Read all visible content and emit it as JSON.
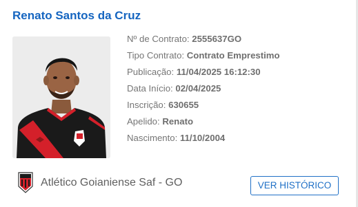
{
  "player": {
    "name": "Renato Santos da Cruz"
  },
  "details": [
    {
      "label": "Nº de Contrato: ",
      "value": "2555637GO"
    },
    {
      "label": "Tipo Contrato: ",
      "value": "Contrato Emprestimo"
    },
    {
      "label": "Publicação: ",
      "value": "11/04/2025 16:12:30"
    },
    {
      "label": "Data Início: ",
      "value": "02/04/2025"
    },
    {
      "label": "Inscrição: ",
      "value": "630655"
    },
    {
      "label": "Apelido: ",
      "value": "Renato"
    },
    {
      "label": "Nascimento: ",
      "value": "11/10/2004"
    }
  ],
  "club": {
    "name": "Atlético Goianiense Saf - GO",
    "logo_icon": "club-crest-icon"
  },
  "actions": {
    "history_label": "VER HISTÓRICO"
  },
  "colors": {
    "accent": "#1565c0",
    "button_border": "#1e6fc6",
    "label_text": "#757575",
    "jersey_red": "#d4202a",
    "jersey_black": "#1a1a1a"
  }
}
